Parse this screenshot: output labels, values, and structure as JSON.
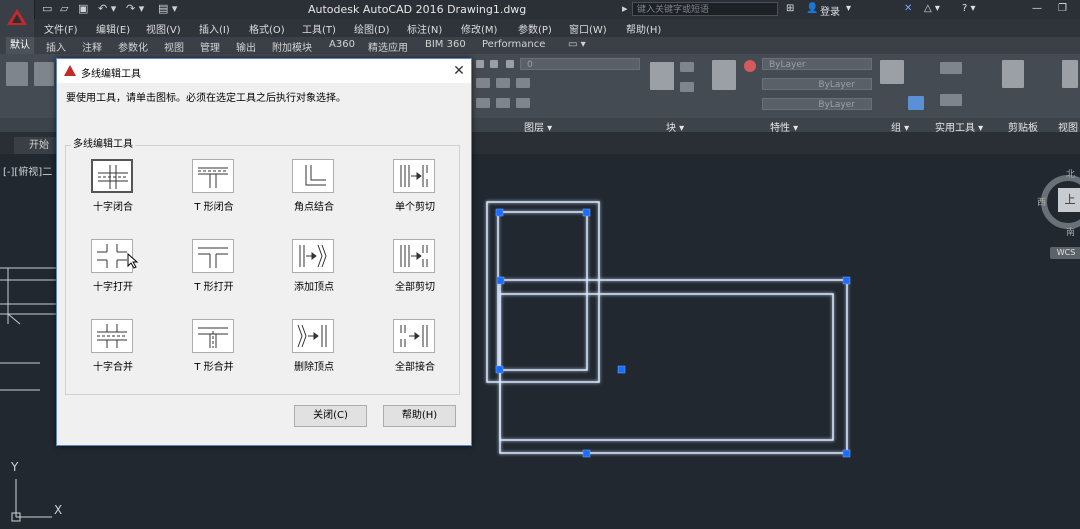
{
  "title_bar": {
    "title": "Autodesk AutoCAD 2016    Drawing1.dwg",
    "search_placeholder": "键入关键字或短语",
    "login_label": "登录"
  },
  "menu_bar": {
    "items": [
      "文件(F)",
      "编辑(E)",
      "视图(V)",
      "插入(I)",
      "格式(O)",
      "工具(T)",
      "绘图(D)",
      "标注(N)",
      "修改(M)",
      "参数(P)",
      "窗口(W)",
      "帮助(H)"
    ]
  },
  "ribbon_tabs": {
    "items": [
      "默认",
      "插入",
      "注释",
      "参数化",
      "视图",
      "管理",
      "输出",
      "附加模块",
      "A360",
      "精选应用",
      "BIM 360",
      "Performance"
    ],
    "active": "默认"
  },
  "ribbon": {
    "layer_value": "0",
    "bylayer_labels": [
      "ByLayer",
      "ByLayer",
      "ByLayer"
    ],
    "panel_titles": [
      "图层 ▾",
      "块 ▾",
      "特性 ▾",
      "组 ▾",
      "实用工具 ▾",
      "剪贴板",
      "视图"
    ]
  },
  "file_tabs": {
    "start_label": "开始"
  },
  "viewport": {
    "label": "[-][俯视]二",
    "compass": {
      "north": "北",
      "west": "西",
      "south": "南"
    },
    "cube_face": "上",
    "wcs_label": "WCS",
    "ucs_y": "Y",
    "ucs_x": "X"
  },
  "dialog": {
    "title": "多线编辑工具",
    "instruction": "要使用工具，请单击图标。必须在选定工具之后执行对象选择。",
    "group_label": "多线编辑工具",
    "tools": [
      {
        "label": "十字闭合",
        "icon": "closed-cross-icon"
      },
      {
        "label": "T 形闭合",
        "icon": "closed-tee-icon"
      },
      {
        "label": "角点结合",
        "icon": "corner-joint-icon"
      },
      {
        "label": "单个剪切",
        "icon": "cut-single-icon"
      },
      {
        "label": "十字打开",
        "icon": "open-cross-icon"
      },
      {
        "label": "T 形打开",
        "icon": "open-tee-icon"
      },
      {
        "label": "添加顶点",
        "icon": "add-vertex-icon"
      },
      {
        "label": "全部剪切",
        "icon": "cut-all-icon"
      },
      {
        "label": "十字合并",
        "icon": "merged-cross-icon"
      },
      {
        "label": "T 形合并",
        "icon": "merged-tee-icon"
      },
      {
        "label": "删除顶点",
        "icon": "delete-vertex-icon"
      },
      {
        "label": "全部接合",
        "icon": "weld-all-icon"
      }
    ],
    "close_button": "关闭(C)",
    "help_button": "帮助(H)"
  },
  "colors": {
    "canvas_bg": "#212830",
    "multiline": "#d8e8ff",
    "grip": "#1a6dff"
  }
}
